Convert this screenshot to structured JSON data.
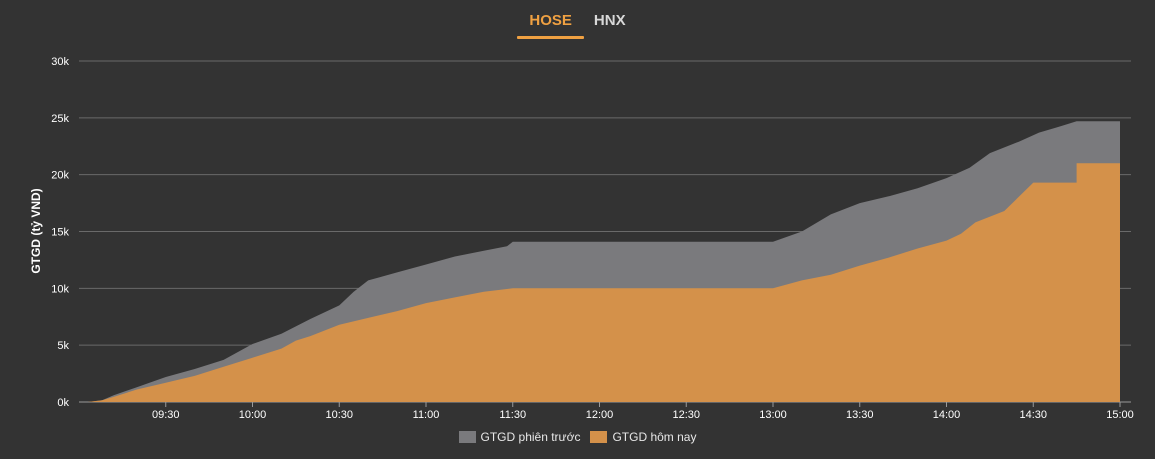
{
  "tabs": [
    {
      "label": "HOSE",
      "active": true
    },
    {
      "label": "HNX",
      "active": false
    }
  ],
  "chart_data": {
    "type": "area",
    "ylabel": "GTGD (tỷ VND)",
    "ylim": [
      0,
      30000
    ],
    "yticks": [
      {
        "value": 0,
        "label": "0k"
      },
      {
        "value": 5000,
        "label": "5k"
      },
      {
        "value": 10000,
        "label": "10k"
      },
      {
        "value": 15000,
        "label": "15k"
      },
      {
        "value": 20000,
        "label": "20k"
      },
      {
        "value": 25000,
        "label": "25k"
      },
      {
        "value": 30000,
        "label": "30k"
      }
    ],
    "xlim": [
      "09:00",
      "15:00"
    ],
    "xticks": [
      "09:30",
      "10:00",
      "10:30",
      "11:00",
      "11:30",
      "12:00",
      "12:30",
      "13:00",
      "13:30",
      "14:00",
      "14:30",
      "15:00"
    ],
    "grid": true,
    "legend_position": "bottom-center",
    "series": [
      {
        "name": "GTGD phiên trước",
        "color": "#7a7a7d",
        "points": [
          [
            "09:03",
            0
          ],
          [
            "09:08",
            150
          ],
          [
            "09:12",
            600
          ],
          [
            "09:20",
            1300
          ],
          [
            "09:30",
            2200
          ],
          [
            "09:40",
            2900
          ],
          [
            "09:50",
            3700
          ],
          [
            "10:00",
            5100
          ],
          [
            "10:10",
            6000
          ],
          [
            "10:20",
            7300
          ],
          [
            "10:30",
            8500
          ],
          [
            "10:35",
            9700
          ],
          [
            "10:40",
            10700
          ],
          [
            "10:50",
            11400
          ],
          [
            "11:00",
            12100
          ],
          [
            "11:10",
            12800
          ],
          [
            "11:20",
            13300
          ],
          [
            "11:28",
            13700
          ],
          [
            "11:30",
            14100
          ],
          [
            "13:00",
            14100
          ],
          [
            "13:10",
            15000
          ],
          [
            "13:20",
            16500
          ],
          [
            "13:30",
            17500
          ],
          [
            "13:40",
            18100
          ],
          [
            "13:50",
            18800
          ],
          [
            "14:00",
            19700
          ],
          [
            "14:08",
            20600
          ],
          [
            "14:15",
            21900
          ],
          [
            "14:25",
            22900
          ],
          [
            "14:32",
            23700
          ],
          [
            "14:40",
            24300
          ],
          [
            "14:45",
            24700
          ],
          [
            "15:00",
            24700
          ]
        ]
      },
      {
        "name": "GTGD hôm nay",
        "color": "#d4914a",
        "points": [
          [
            "09:03",
            0
          ],
          [
            "09:08",
            150
          ],
          [
            "09:12",
            450
          ],
          [
            "09:20",
            1100
          ],
          [
            "09:30",
            1700
          ],
          [
            "09:40",
            2300
          ],
          [
            "09:50",
            3100
          ],
          [
            "10:00",
            3900
          ],
          [
            "10:10",
            4700
          ],
          [
            "10:15",
            5400
          ],
          [
            "10:20",
            5800
          ],
          [
            "10:30",
            6800
          ],
          [
            "10:40",
            7400
          ],
          [
            "10:50",
            8000
          ],
          [
            "11:00",
            8700
          ],
          [
            "11:10",
            9200
          ],
          [
            "11:20",
            9700
          ],
          [
            "11:30",
            10000
          ],
          [
            "13:00",
            10000
          ],
          [
            "13:10",
            10700
          ],
          [
            "13:20",
            11200
          ],
          [
            "13:30",
            12000
          ],
          [
            "13:40",
            12700
          ],
          [
            "13:50",
            13500
          ],
          [
            "14:00",
            14200
          ],
          [
            "14:05",
            14800
          ],
          [
            "14:10",
            15800
          ],
          [
            "14:20",
            16800
          ],
          [
            "14:30",
            19300
          ],
          [
            "14:45",
            19300
          ],
          [
            "14:45",
            21000
          ],
          [
            "15:00",
            21000
          ]
        ]
      }
    ]
  }
}
